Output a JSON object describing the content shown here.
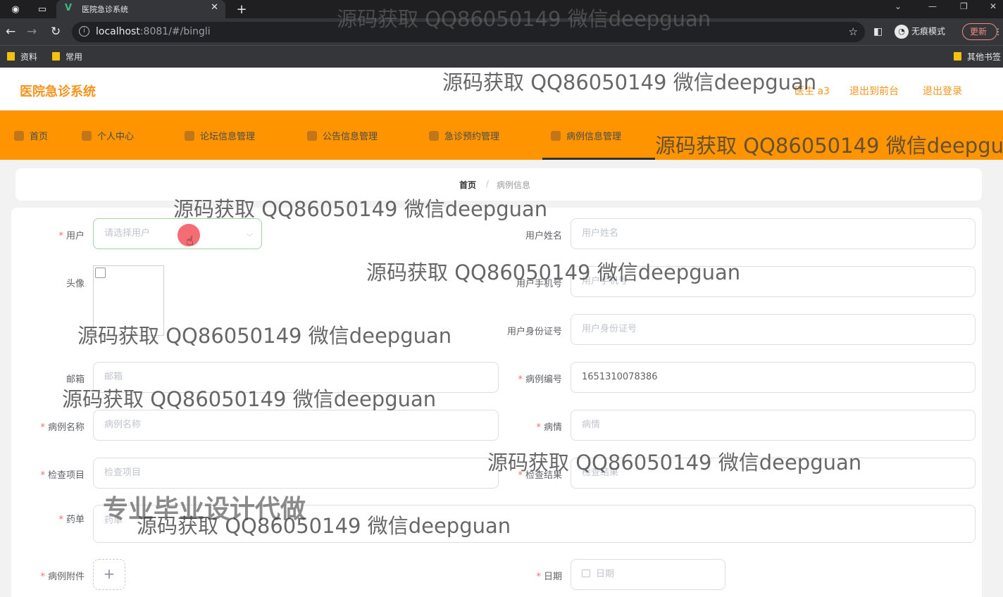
{
  "browser": {
    "tab_title": "医院急诊系统",
    "url_host": "localhost",
    "url_rest": ":8081/#/bingli",
    "incognito_label": "无痕模式",
    "update_label": "更新",
    "bookmarks": [
      "资料",
      "常用"
    ],
    "other_bookmarks": "其他书签"
  },
  "header": {
    "app_title": "医院急诊系统",
    "user": "医生 a3",
    "back_front": "退出到前台",
    "logout": "退出登录"
  },
  "nav": [
    "首页",
    "个人中心",
    "论坛信息管理",
    "公告信息管理",
    "急诊预约管理",
    "病例信息管理"
  ],
  "breadcrumb": {
    "home": "首页",
    "sep": "/",
    "current": "病例信息"
  },
  "form": {
    "user_label": "用户",
    "user_placeholder": "请选择用户",
    "username_label": "用户姓名",
    "username_placeholder": "用户姓名",
    "avatar_label": "头像",
    "phone_label": "用户手机号",
    "phone_placeholder": "用户手机号",
    "idcard_label": "用户身份证号",
    "idcard_placeholder": "用户身份证号",
    "email_label": "邮箱",
    "email_placeholder": "邮箱",
    "caseno_label": "病例编号",
    "caseno_value": "1651310078386",
    "casename_label": "病例名称",
    "casename_placeholder": "病例名称",
    "condition_label": "病情",
    "condition_placeholder": "病情",
    "exam_label": "检查项目",
    "exam_placeholder": "检查项目",
    "result_label": "检查结果",
    "result_placeholder": "检查结果",
    "rx_label": "药单",
    "rx_placeholder": "药单",
    "attach_label": "病例附件",
    "date_label": "日期",
    "date_placeholder": "日期"
  },
  "watermarks": {
    "qq": "源码获取 QQ86050149 微信deepguan",
    "promo": "专业毕业设计代做"
  }
}
